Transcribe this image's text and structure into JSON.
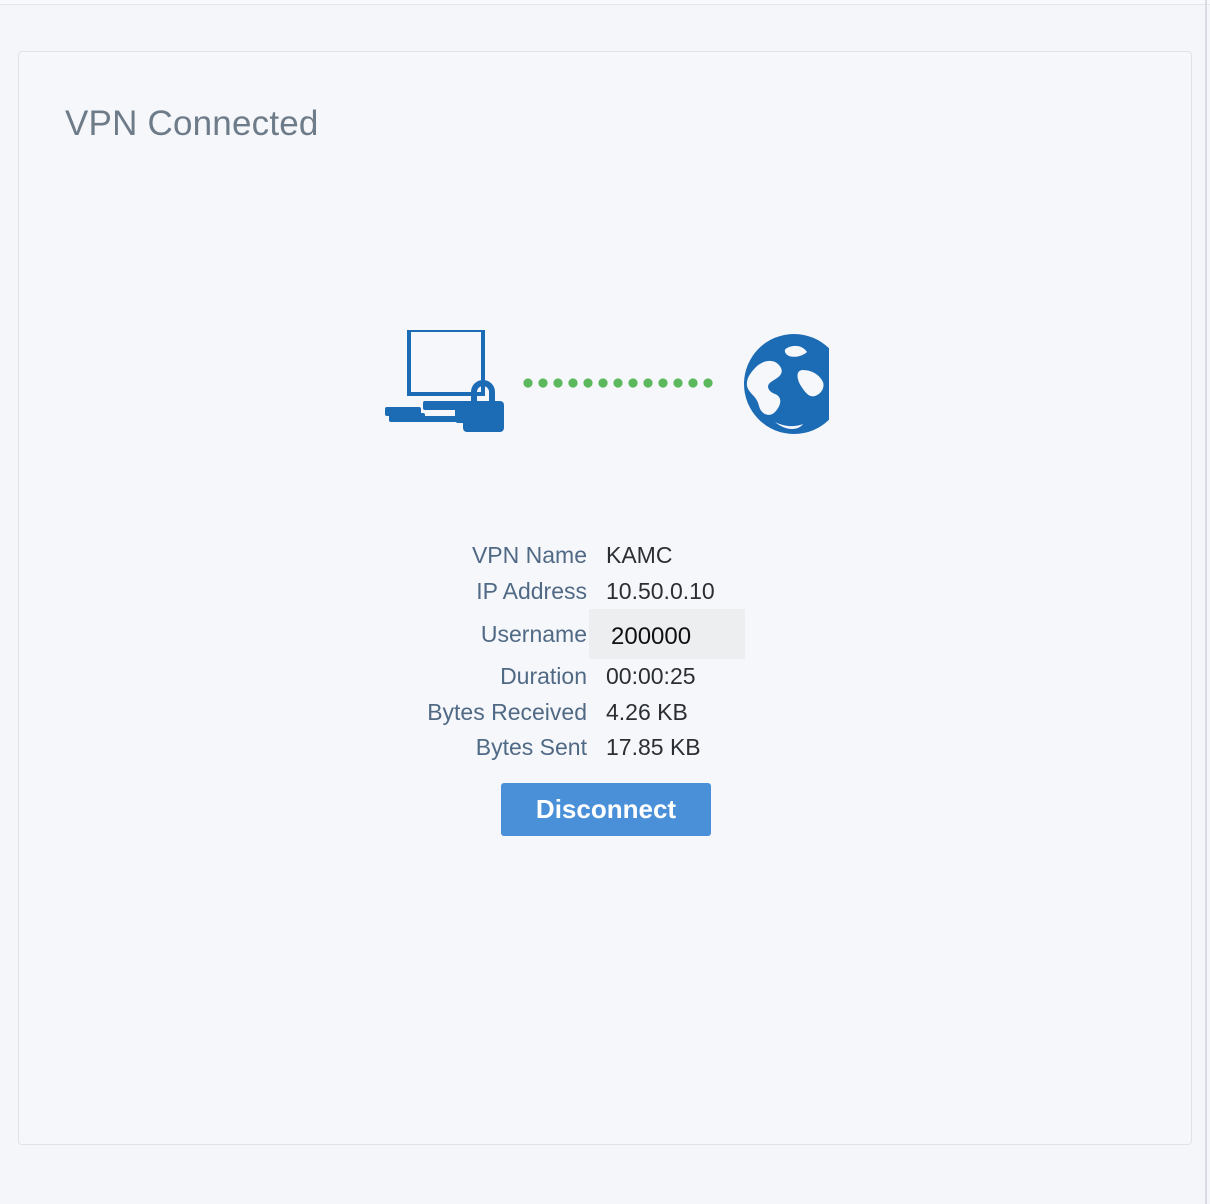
{
  "panel": {
    "title": "VPN Connected"
  },
  "illustration": {
    "left_icon": "computer-lock-icon",
    "connector": "dotted-connection-line",
    "right_icon": "globe-icon",
    "colors": {
      "icon": "#1c6bb5",
      "connector": "#5cb85c"
    }
  },
  "info": {
    "rows": [
      {
        "label": "VPN Name",
        "value": "KAMC"
      },
      {
        "label": "IP Address",
        "value": "10.50.0.10"
      },
      {
        "label": "Username",
        "value": "200000"
      },
      {
        "label": "Duration",
        "value": "00:00:25"
      },
      {
        "label": "Bytes Received",
        "value": "4.26 KB"
      },
      {
        "label": "Bytes Sent",
        "value": "17.85 KB"
      }
    ]
  },
  "actions": {
    "disconnect_label": "Disconnect",
    "button_color": "#4a90d9"
  }
}
